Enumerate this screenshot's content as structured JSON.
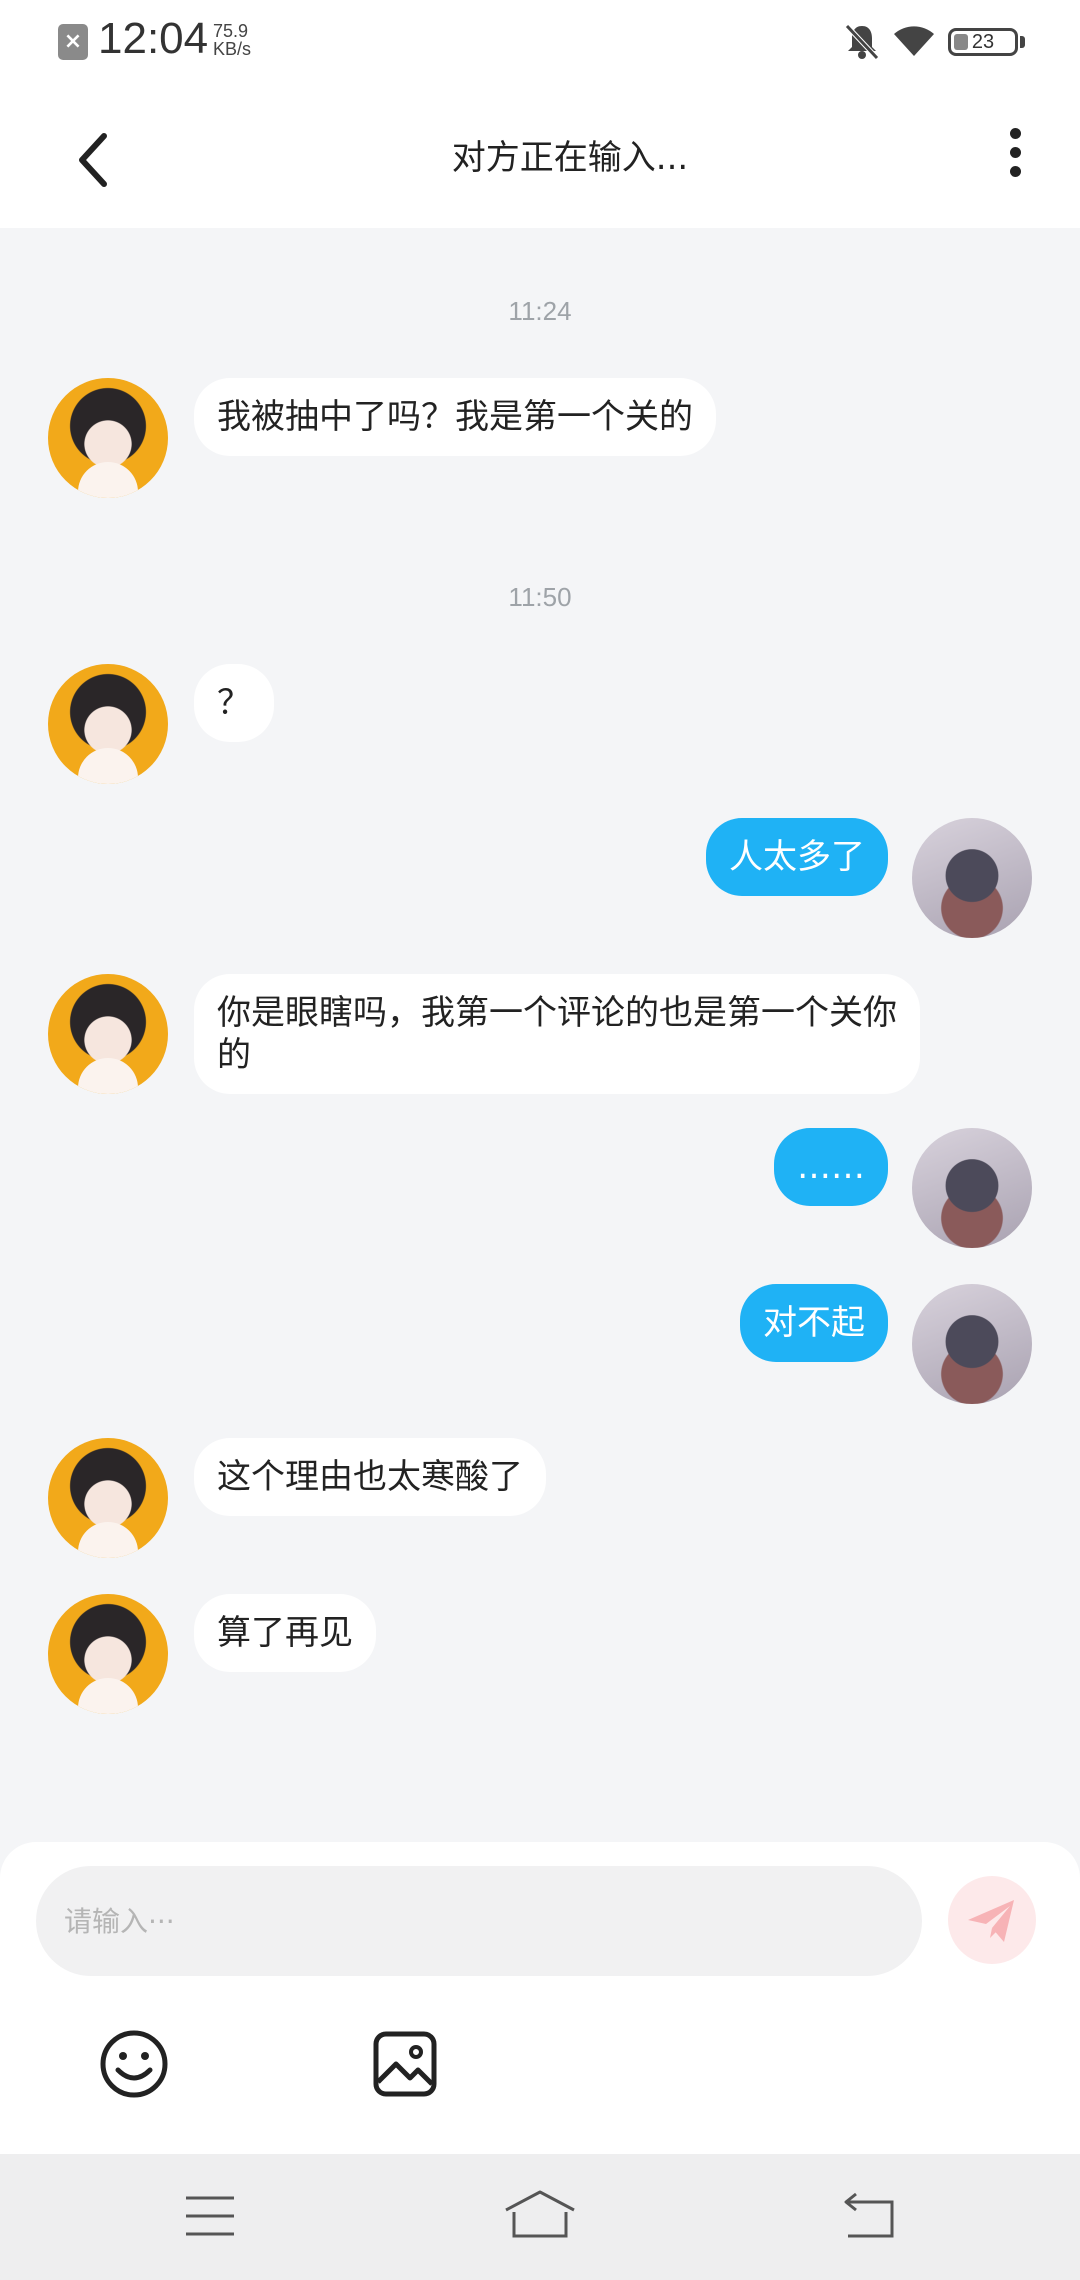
{
  "status_bar": {
    "time": "12:04",
    "net_speed_value": "75.9",
    "net_speed_unit": "KB/s",
    "battery": "23"
  },
  "header": {
    "title": "对方正在输入..."
  },
  "chat": {
    "timestamps": [
      "11:24",
      "11:50"
    ],
    "messages": [
      {
        "side": "in",
        "text": "我被抽中了吗？我是第一个关的"
      },
      {
        "side": "in",
        "text": "？"
      },
      {
        "side": "out",
        "text": "人太多了"
      },
      {
        "side": "in",
        "text": "你是眼瞎吗，我第一个评论的也是第一个关你的"
      },
      {
        "side": "out",
        "text": "……"
      },
      {
        "side": "out",
        "text": "对不起"
      },
      {
        "side": "in",
        "text": "这个理由也太寒酸了"
      },
      {
        "side": "in",
        "text": "算了再见"
      }
    ]
  },
  "input": {
    "placeholder": "请输入···"
  },
  "colors": {
    "outgoing_bubble": "#1fb2f5",
    "incoming_bubble": "#ffffff",
    "background": "#f4f5f7",
    "send_button": "#f5898e"
  },
  "icons": {
    "back": "chevron-left-icon",
    "more": "more-vertical-icon",
    "send": "paper-plane-icon",
    "emoji": "smiley-icon",
    "image": "image-icon",
    "nav_menu": "menu-icon",
    "nav_home": "home-icon",
    "nav_back": "back-icon"
  }
}
